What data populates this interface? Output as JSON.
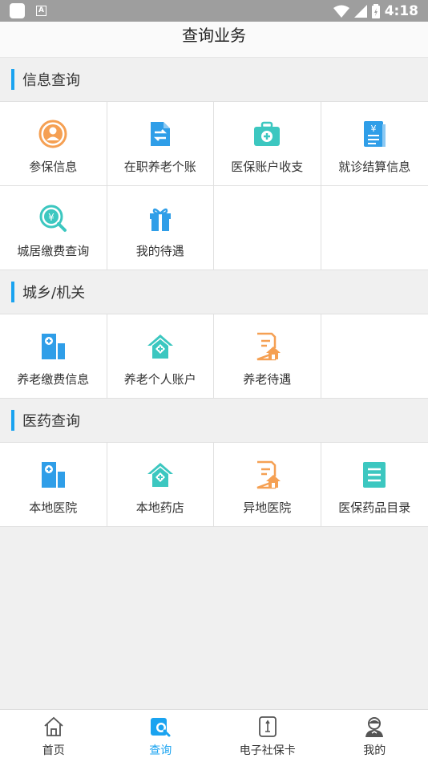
{
  "status_bar": {
    "time": "4:18"
  },
  "header": {
    "title": "查询业务"
  },
  "sections": [
    {
      "title": "信息查询",
      "items": [
        "参保信息",
        "在职养老个账",
        "医保账户收支",
        "就诊结算信息",
        "城居缴费查询",
        "我的待遇"
      ]
    },
    {
      "title": "城乡/机关",
      "items": [
        "养老缴费信息",
        "养老个人账户",
        "养老待遇"
      ]
    },
    {
      "title": "医药查询",
      "items": [
        "本地医院",
        "本地药店",
        "异地医院",
        "医保药品目录"
      ]
    }
  ],
  "tabbar": {
    "tabs": [
      "首页",
      "查询",
      "电子社保卡",
      "我的"
    ],
    "active": "查询"
  },
  "colors": {
    "accent": "#1aa3f0",
    "orange": "#f5a053",
    "teal": "#3cc7c0",
    "blue": "#2f9ee8"
  }
}
